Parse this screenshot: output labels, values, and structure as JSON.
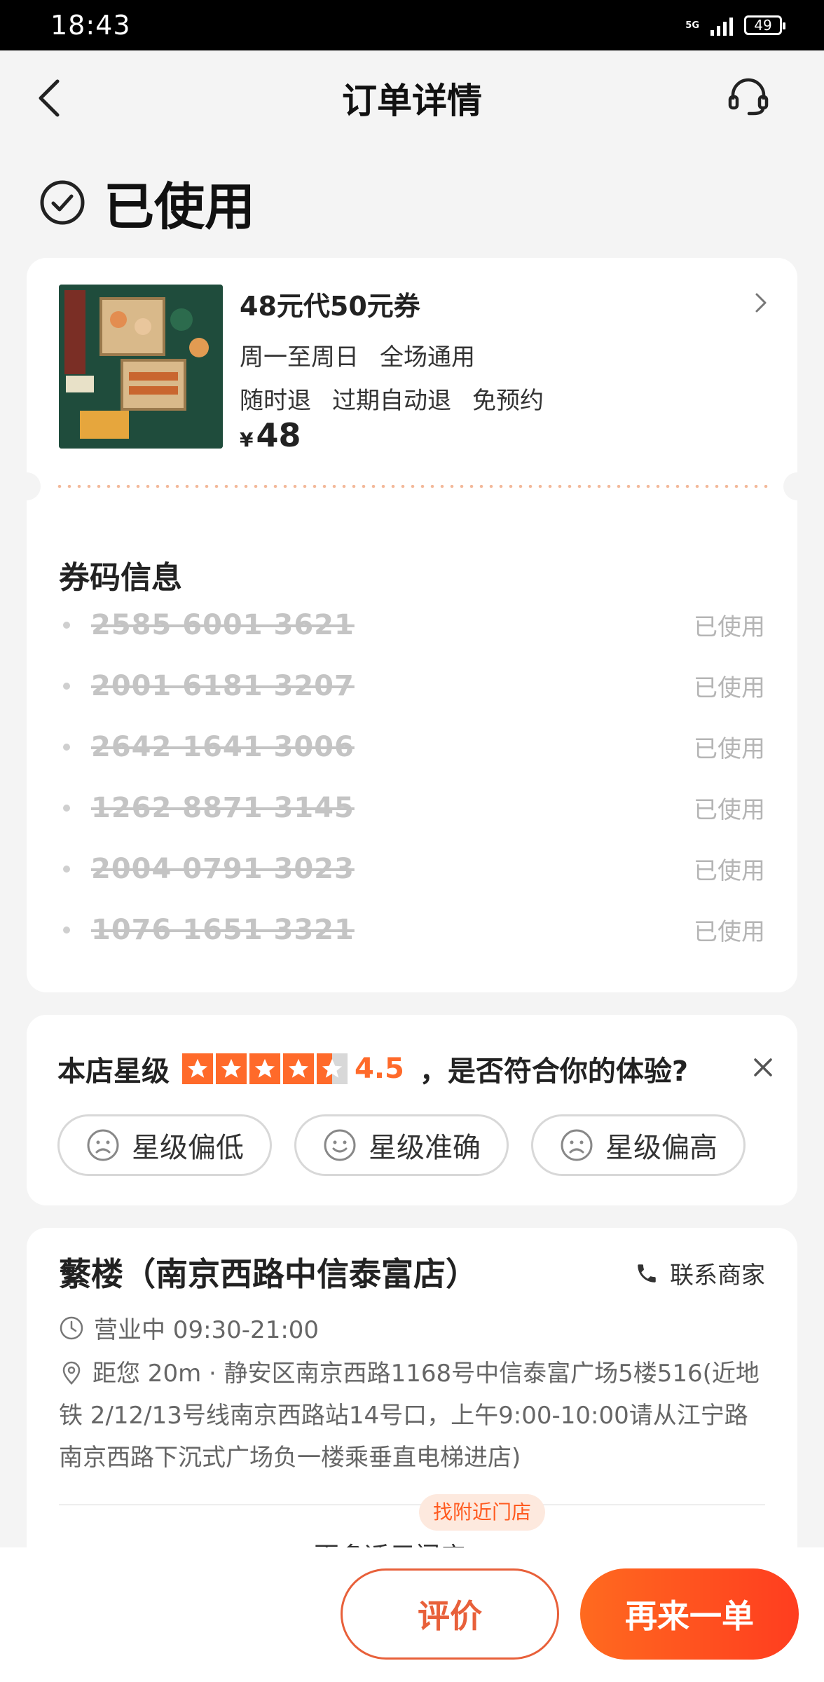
{
  "status_bar": {
    "time": "18:43",
    "network": "5G",
    "battery": "49"
  },
  "nav": {
    "title": "订单详情"
  },
  "order_status": "已使用",
  "deal": {
    "title": "48元代50元券",
    "tags_row1": [
      "周一至周日",
      "全场通用"
    ],
    "tags_row2": [
      "随时退",
      "过期自动退",
      "免预约"
    ],
    "price_symbol": "¥",
    "price": "48"
  },
  "codes_section": {
    "title": "券码信息",
    "codes": [
      {
        "code": "2585 6001 3621",
        "state": "已使用"
      },
      {
        "code": "2001 6181 3207",
        "state": "已使用"
      },
      {
        "code": "2642 1641 3006",
        "state": "已使用"
      },
      {
        "code": "1262 8871 3145",
        "state": "已使用"
      },
      {
        "code": "2004 0791 3023",
        "state": "已使用"
      },
      {
        "code": "1076 1651 3321",
        "state": "已使用"
      }
    ]
  },
  "rating": {
    "label": "本店星级",
    "score": "4.5",
    "stars_value": 4.5,
    "question": "，是否符合你的体验?",
    "options": [
      "星级偏低",
      "星级准确",
      "星级偏高"
    ]
  },
  "shop": {
    "name": "蘩楼（南京西路中信泰富店）",
    "contact_label": "联系商家",
    "hours": "营业中 09:30-21:00",
    "address": "距您 20m · 静安区南京西路1168号中信泰富广场5楼516(近地铁 2/12/13号线南京西路站14号口，上午9:00-10:00请从江宁路南京西路下沉式广场负一楼乘垂直电梯进店)",
    "nearby_tag": "找附近门店",
    "more_stores": "更多适用门店 >"
  },
  "actions": {
    "review": "评价",
    "reorder": "再来一单"
  },
  "colors": {
    "accent": "#ff6a2a",
    "background": "#f4f4f4"
  }
}
